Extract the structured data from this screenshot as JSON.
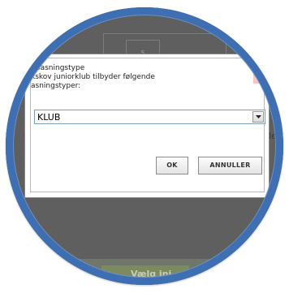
{
  "background": {
    "diagram_box_label": "5",
    "left_fragment_1": "e",
    "left_fragment_2": "n",
    "right_fragment": "de",
    "bottom_button_label": "Vælg ini"
  },
  "dialog": {
    "title_line1": "; pasningstype",
    "title_line2": "kskov juniorklub tilbyder følgende",
    "title_line3": "asningstyper:",
    "select": {
      "selected_value": "KLUB"
    },
    "ok_label": "OK",
    "cancel_label": "ANNULLER"
  },
  "colors": {
    "ring": "#3f6fb3",
    "overlay": "#5f5f5f",
    "dialog_bg": "#ffffff",
    "close_icon": "#e0302a"
  }
}
